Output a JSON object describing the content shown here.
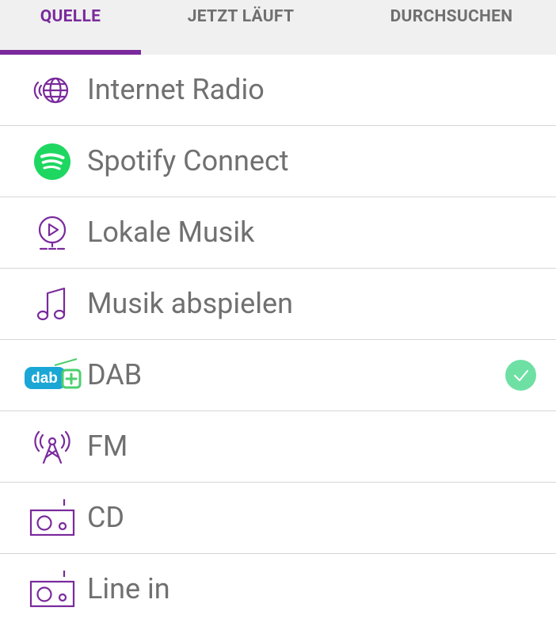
{
  "tabs": [
    {
      "label": "QUELLE",
      "active": true
    },
    {
      "label": "JETZT LÄUFT",
      "active": false
    },
    {
      "label": "DURCHSUCHEN",
      "active": false
    }
  ],
  "sources": [
    {
      "label": "Internet Radio",
      "icon": "internet-radio-icon",
      "selected": false
    },
    {
      "label": "Spotify Connect",
      "icon": "spotify-icon",
      "selected": false
    },
    {
      "label": "Lokale Musik",
      "icon": "local-music-icon",
      "selected": false
    },
    {
      "label": "Musik abspielen",
      "icon": "music-note-icon",
      "selected": false
    },
    {
      "label": "DAB",
      "icon": "dab-plus-icon",
      "selected": true
    },
    {
      "label": "FM",
      "icon": "fm-antenna-icon",
      "selected": false
    },
    {
      "label": "CD",
      "icon": "radio-device-icon",
      "selected": false
    },
    {
      "label": "Line in",
      "icon": "radio-device-icon",
      "selected": false
    }
  ],
  "dab_logo": {
    "text": "dab"
  },
  "colors": {
    "accent": "#7a2a9c",
    "spotify": "#1ed760",
    "dab_blue": "#1aa7d6",
    "dab_green": "#4ccf6f",
    "check": "#6fe0a4",
    "text": "#707070",
    "tabbar_bg": "#f0f0f0"
  }
}
